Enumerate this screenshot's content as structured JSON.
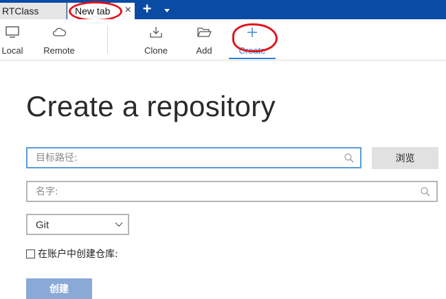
{
  "tabs": {
    "inactive_label": "RTClass",
    "active_label": "New tab",
    "close_glyph": "×",
    "add_glyph": "+"
  },
  "toolbar": {
    "local_label": "Local",
    "remote_label": "Remote",
    "clone_label": "Clone",
    "add_label": "Add",
    "create_label": "Create",
    "icons": [
      "monitor-icon",
      "cloud-icon",
      "download-icon",
      "folder-open-icon",
      "plus-icon"
    ]
  },
  "main": {
    "title": "Create a repository",
    "path_placeholder": "目标路径:",
    "name_placeholder": "名字:",
    "browse_label": "浏览",
    "vcs_selected": "Git",
    "checkbox_label": "在账户中创建仓库:",
    "create_button_label": "创建"
  },
  "colors": {
    "tabstrip": "#0a4ba3",
    "accent": "#2b7fd6",
    "annotation": "#e0141b",
    "create_button": "#8aa9d6"
  }
}
